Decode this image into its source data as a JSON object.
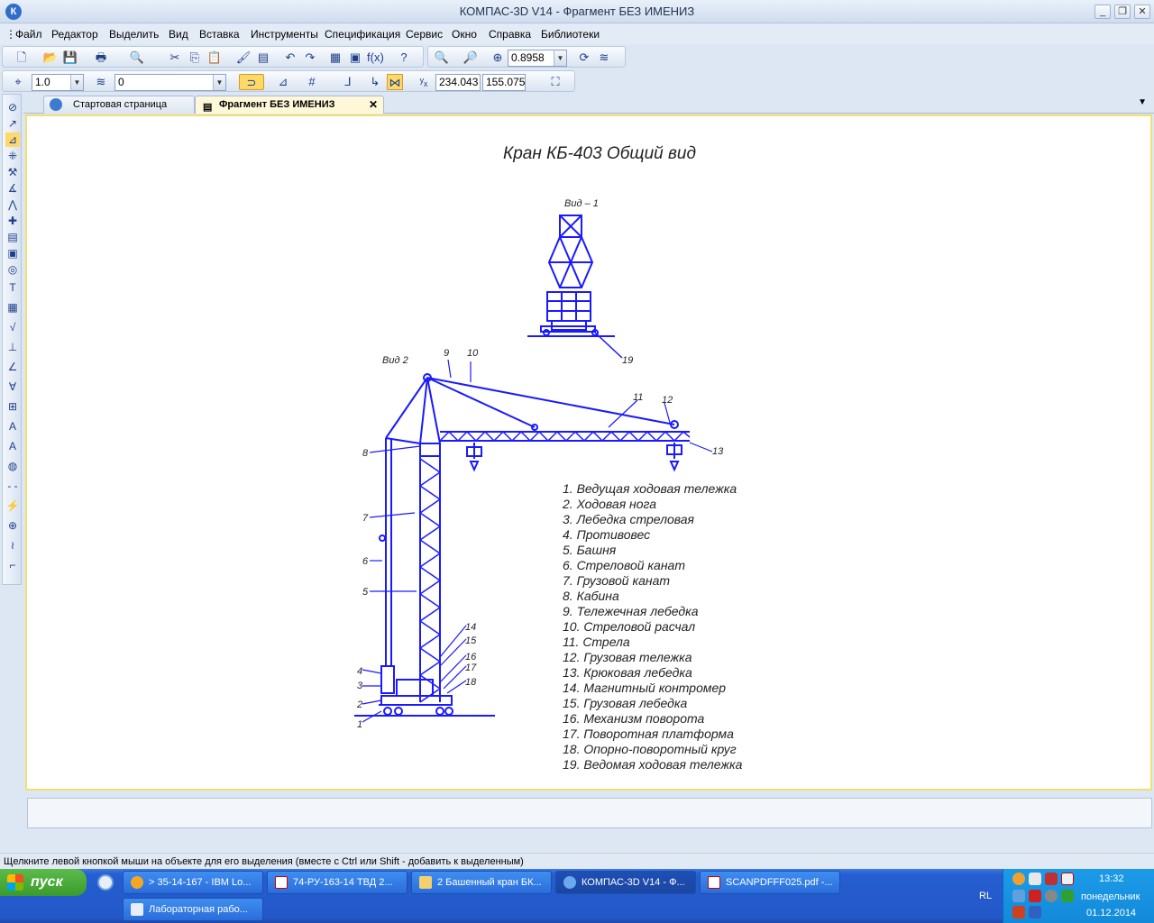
{
  "window": {
    "title": "КОМПАС-3D V14 - Фрагмент БЕЗ ИМЕНИЗ",
    "app_icon": "К"
  },
  "menu": [
    {
      "label": "Файл"
    },
    {
      "label": "Редактор"
    },
    {
      "label": "Выделить"
    },
    {
      "label": "Вид"
    },
    {
      "label": "Вставка"
    },
    {
      "label": "Инструменты"
    },
    {
      "label": "Спецификация"
    },
    {
      "label": "Сервис"
    },
    {
      "label": "Окно"
    },
    {
      "label": "Справка"
    },
    {
      "label": "Библиотеки"
    }
  ],
  "toolbar": {
    "zoom_value": "0.8958",
    "step_value": "1.0",
    "layer_value": "0",
    "coord_x": "234.043",
    "coord_y": "155.075"
  },
  "tabs": [
    {
      "label": "Стартовая страница"
    },
    {
      "label": "Фрагмент БЕЗ ИМЕНИЗ"
    }
  ],
  "drawing": {
    "title": "Кран КБ-403 Общий вид",
    "view1_label": "Вид – 1",
    "view2_label": "Вид 2",
    "callout_19": "19",
    "callouts_side": [
      "9",
      "10",
      "11",
      "12",
      "13",
      "8",
      "7",
      "6",
      "5",
      "4",
      "3",
      "2",
      "1",
      "14",
      "15",
      "16",
      "17",
      "18"
    ],
    "legend": [
      "1. Ведущая ходовая тележка",
      "2. Ходовая нога",
      "3. Лебедка стреловая",
      "4. Противовес",
      "5. Башня",
      "6. Стреловой канат",
      "7. Грузовой канат",
      "8. Кабина",
      "9. Тележечная лебедка",
      "10. Стреловой расчал",
      "11. Стрела",
      "12. Грузовая тележка",
      "13. Крюковая лебедка",
      "14. Магнитный контромер",
      "15. Грузовая лебедка",
      "16. Механизм поворота",
      "17. Поворотная платформа",
      "18. Опорно-поворотный круг",
      "19. Ведомая ходовая тележка"
    ],
    "line_color": "#1a1aff"
  },
  "status": {
    "hint": "Щелкните левой кнопкой мыши на объекте для его выделения (вместе с Ctrl или Shift - добавить к выделенным)"
  },
  "taskbar": {
    "start_label": "пуск",
    "tasks": [
      {
        "label": "> 35-14-167 - IBM Lo..."
      },
      {
        "label": "74-РУ-163-14 ТВД 2..."
      },
      {
        "label": "2 Башенный кран БК..."
      },
      {
        "label": "КОМПАС-3D V14 - Ф..."
      },
      {
        "label": "SCANPDFFF025.pdf -..."
      },
      {
        "label": "Лабораторная рабо..."
      }
    ],
    "lang": "RL",
    "time": "13:32",
    "day": "понедельник",
    "date": "01.12.2014"
  }
}
